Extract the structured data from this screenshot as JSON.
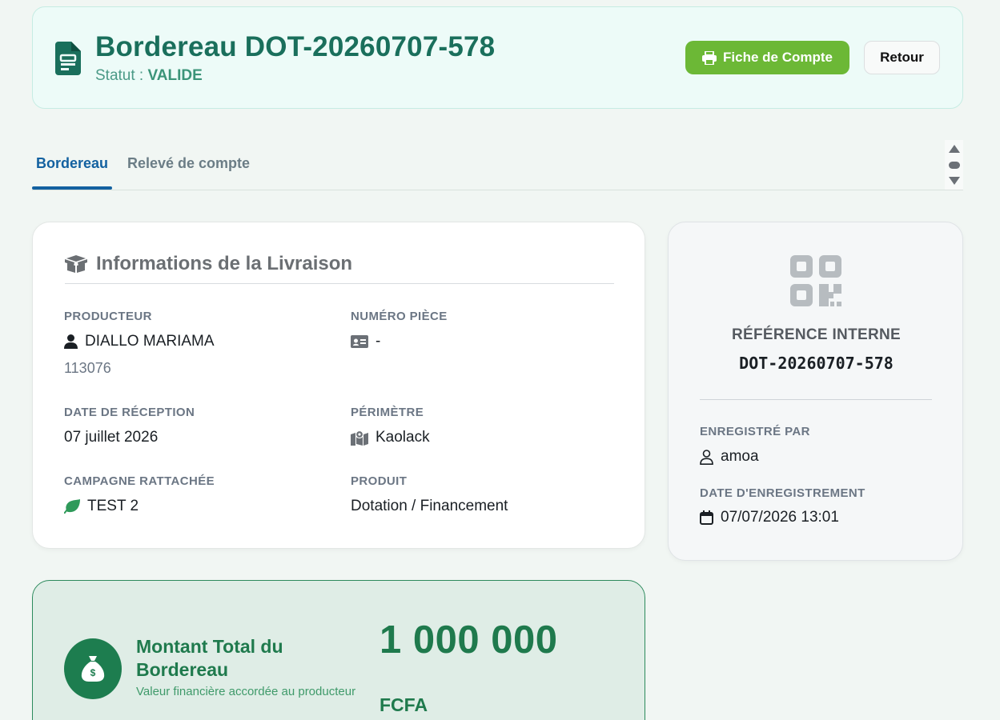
{
  "header": {
    "title": "Bordereau DOT-20260707-578",
    "status_label": "Statut :",
    "status_value": "VALIDE",
    "fiche_button": "Fiche de Compte",
    "retour_button": "Retour"
  },
  "tabs": [
    {
      "label": "Bordereau",
      "active": true
    },
    {
      "label": "Relevé de compte",
      "active": false
    }
  ],
  "info": {
    "title": "Informations de la Livraison",
    "producteur_label": "PRODUCTEUR",
    "producteur_name": "DIALLO MARIAMA",
    "producteur_id": "113076",
    "numero_piece_label": "NUMÉRO PIÈCE",
    "numero_piece_value": "-",
    "date_reception_label": "DATE DE RÉCEPTION",
    "date_reception_value": "07 juillet 2026",
    "perimetre_label": "PÉRIMÈTRE",
    "perimetre_value": "Kaolack",
    "campagne_label": "CAMPAGNE RATTACHÉE",
    "campagne_value": "TEST 2",
    "produit_label": "PRODUIT",
    "produit_value": "Dotation / Financement"
  },
  "reference": {
    "label": "RÉFÉRENCE INTERNE",
    "code": "DOT-20260707-578",
    "enregistre_par_label": "ENREGISTRÉ PAR",
    "enregistre_par_value": "amoa",
    "date_enregistrement_label": "DATE D'ENREGISTREMENT",
    "date_enregistrement_value": "07/07/2026 13:01"
  },
  "amount": {
    "title": "Montant Total du Bordereau",
    "subtitle": "Valeur financière accordée au producteur",
    "value": "1 000 000",
    "currency": "FCFA"
  },
  "colors": {
    "primary_green": "#1a6f5c",
    "action_green": "#6cb836",
    "tab_blue": "#1361a0",
    "amount_green": "#1f7a4d"
  },
  "icons": {
    "header": "document-icon",
    "print": "printer-icon",
    "info": "box-open-icon",
    "producteur": "user-icon",
    "piece": "id-card-icon",
    "perimetre": "map-location-icon",
    "campagne": "leaf-icon",
    "qr": "qrcode-icon",
    "enregistre": "user-outline-icon",
    "date": "calendar-icon",
    "amount": "money-bag-icon"
  }
}
